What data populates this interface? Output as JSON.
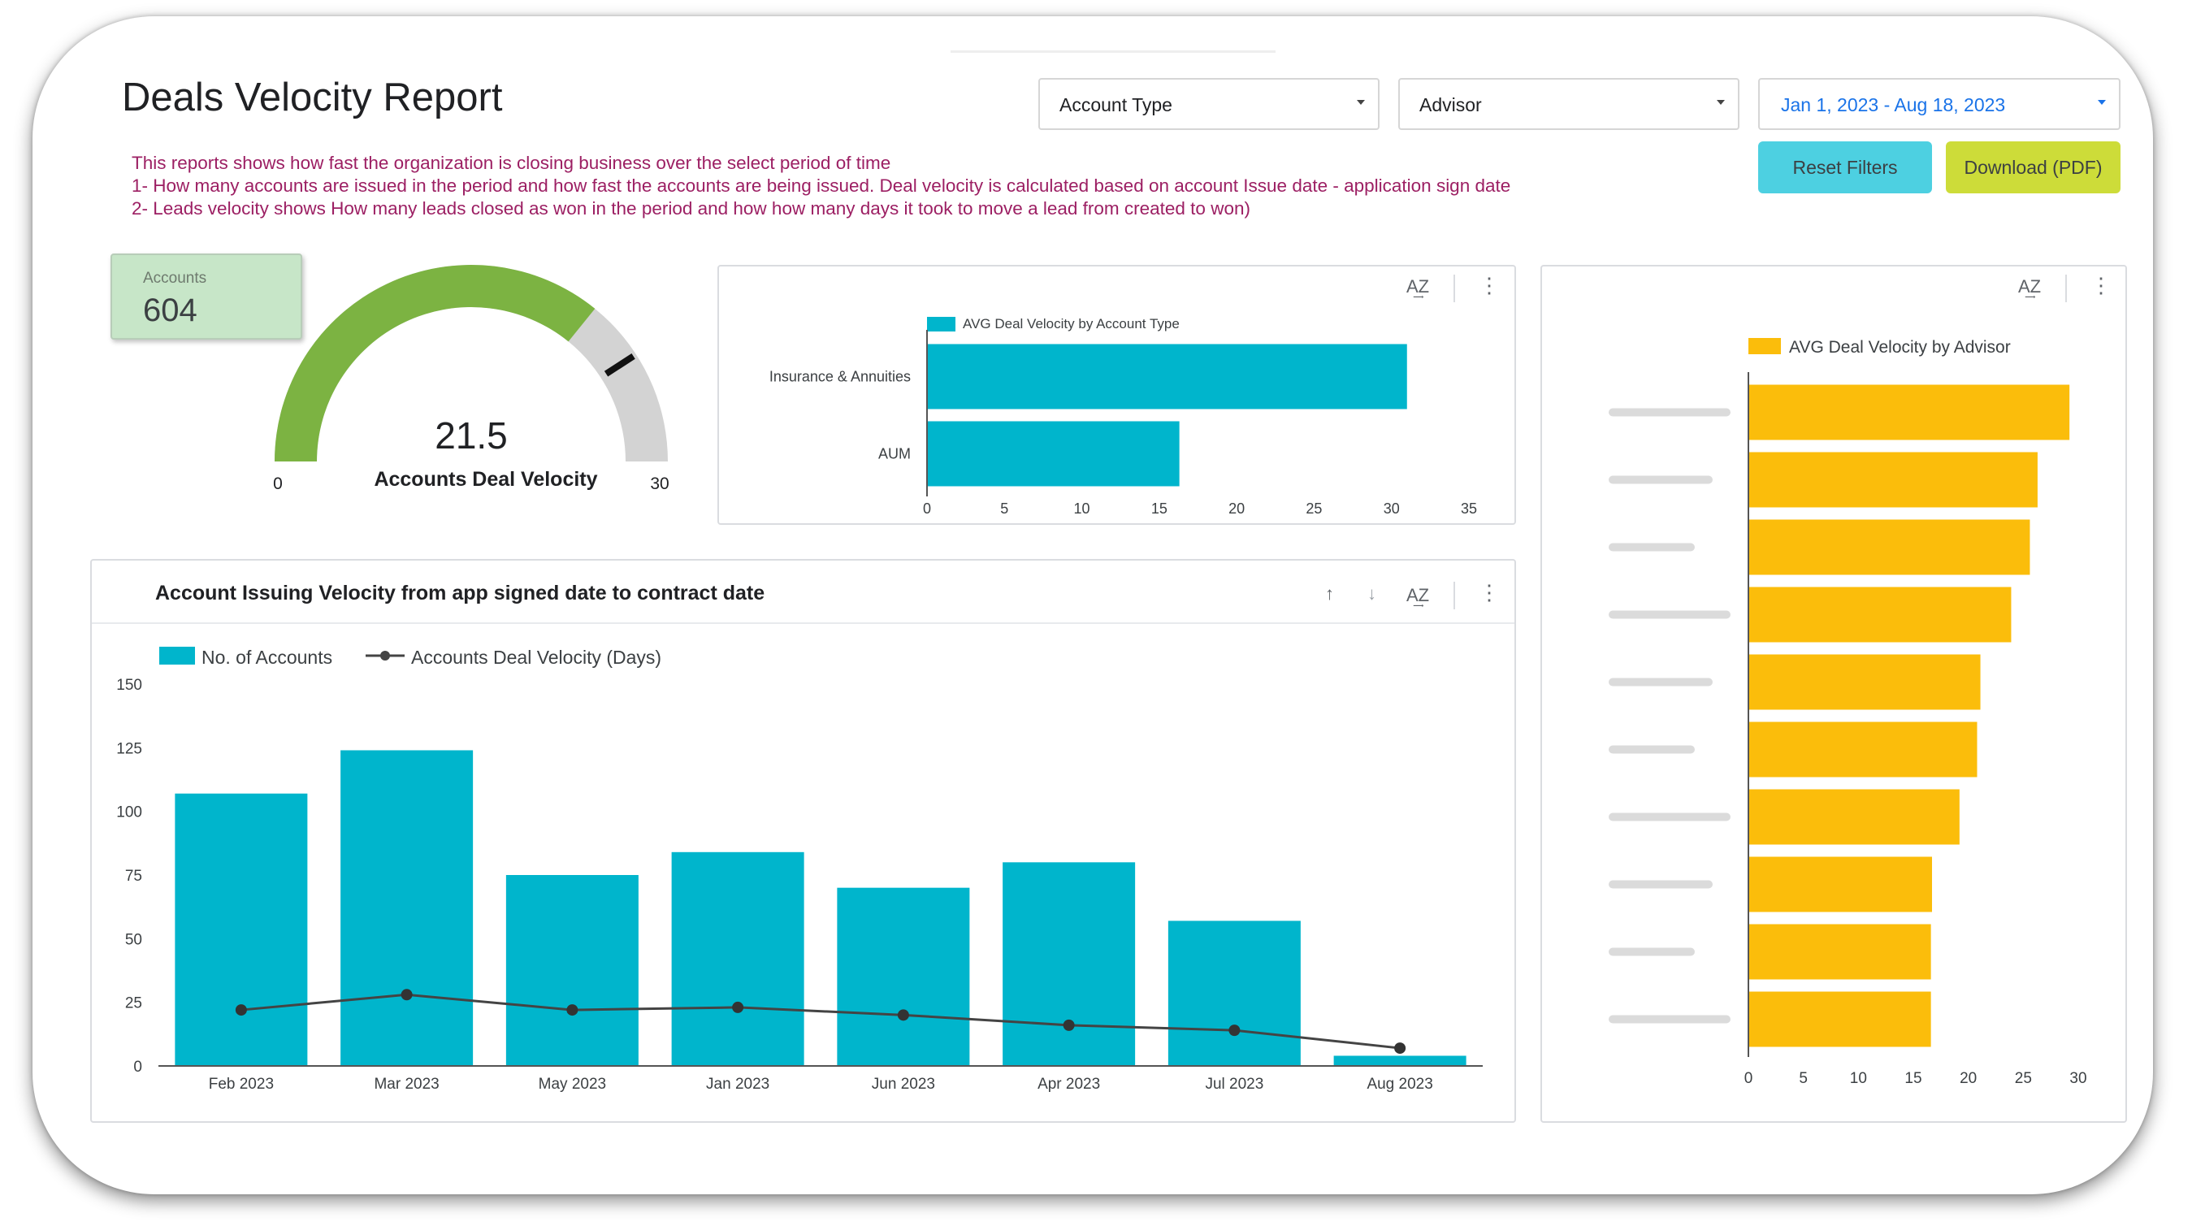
{
  "header": {
    "title": "Deals Velocity Report",
    "description": [
      "This reports shows how fast the organization is closing business over the select period of time",
      "1- How many accounts are issued in the period and how fast the accounts are being issued. Deal velocity is calculated based on account Issue date - application sign date",
      "2- Leads velocity shows How many leads closed as won in the period and how how many days it took to move a lead from created to won)"
    ]
  },
  "filters": {
    "account_type": "Account Type",
    "advisor": "Advisor",
    "date_range": "Jan 1, 2023 - Aug 18, 2023",
    "reset_label": "Reset Filters",
    "download_label": "Download (PDF)"
  },
  "colors": {
    "teal": "#00b5cc",
    "amber": "#fbbd0b",
    "gauge_green": "#7cb342",
    "gauge_grey": "#d3d3d3",
    "reset_btn": "#4dd0e1",
    "download_btn": "#cddc39",
    "description_text": "#9c1f63",
    "date_text": "#1a73e8"
  },
  "scorecard": {
    "label": "Accounts",
    "value": "604"
  },
  "gauge": {
    "value": 21.5,
    "value_text": "21.5",
    "label": "Accounts Deal Velocity",
    "min": 0,
    "max": 30,
    "min_text": "0",
    "max_text": "30",
    "target": 24.5
  },
  "icons": {
    "sort_az": "sort-az-icon",
    "more": "more-vert-icon",
    "sort_asc": "arrow-up-icon",
    "sort_desc": "arrow-down-icon"
  },
  "chart_data": [
    {
      "type": "bar",
      "orientation": "horizontal",
      "legend": "AVG Deal Velocity by Account Type",
      "categories": [
        "Insurance & Annuities",
        "AUM"
      ],
      "values": [
        31,
        16.3
      ],
      "xlim": [
        0,
        35
      ],
      "xticks": [
        "0",
        "5",
        "10",
        "15",
        "20",
        "25",
        "30",
        "35"
      ]
    },
    {
      "type": "bar",
      "orientation": "horizontal",
      "legend": "AVG Deal Velocity by Advisor",
      "categories_obscured": true,
      "values": [
        29.2,
        26.3,
        25.6,
        23.9,
        21.1,
        20.8,
        19.2,
        16.7,
        16.6,
        16.6
      ],
      "xlim": [
        0,
        30
      ],
      "xticks": [
        "0",
        "5",
        "10",
        "15",
        "20",
        "25",
        "30"
      ]
    },
    {
      "type": "bar+line",
      "title": "Account Issuing Velocity from app signed date to contract date",
      "categories": [
        "Feb 2023",
        "Mar 2023",
        "May 2023",
        "Jan 2023",
        "Jun 2023",
        "Apr 2023",
        "Jul 2023",
        "Aug 2023"
      ],
      "series": [
        {
          "name": "No. of Accounts",
          "type": "bar",
          "values": [
            107,
            124,
            75,
            84,
            70,
            80,
            57,
            4
          ]
        },
        {
          "name": "Accounts Deal Velocity (Days)",
          "type": "line",
          "values": [
            22,
            28,
            22,
            23,
            20,
            16,
            14,
            7
          ]
        }
      ],
      "ylim": [
        0,
        150
      ],
      "yticks": [
        "0",
        "25",
        "50",
        "75",
        "100",
        "125",
        "150"
      ],
      "legend_position": "top-left"
    }
  ]
}
